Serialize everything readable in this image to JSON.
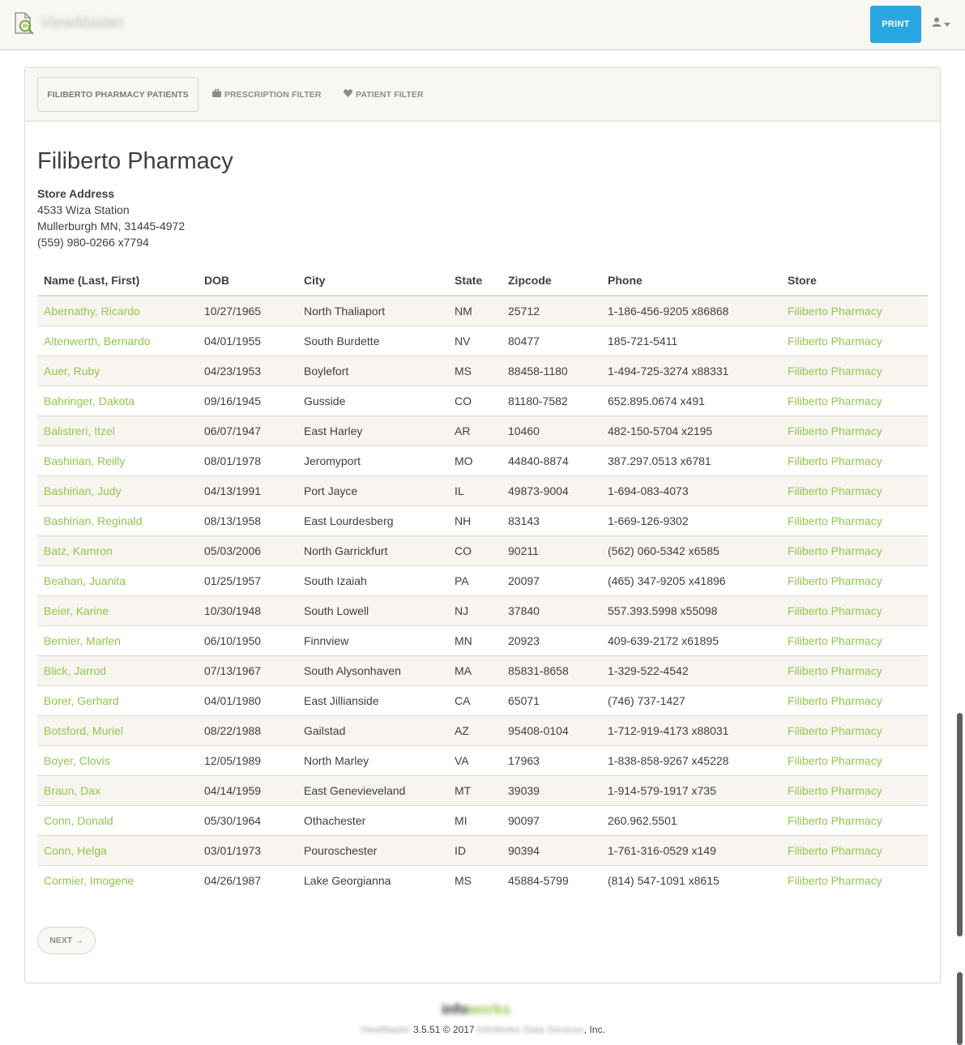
{
  "navbar": {
    "brand_name": "ViewMaster",
    "print_label": "PRINT"
  },
  "tabs": [
    {
      "label": "FILIBERTO PHARMACY PATIENTS",
      "icon": null
    },
    {
      "label": "PRESCRIPTION FILTER",
      "icon": "briefcase-icon"
    },
    {
      "label": "PATIENT FILTER",
      "icon": "heart-icon"
    }
  ],
  "store": {
    "name": "Filiberto Pharmacy",
    "address_label": "Store Address",
    "street": "4533 Wiza Station",
    "city_line": "Mullerburgh MN, 31445-4972",
    "phone": "(559) 980-0266 x7794"
  },
  "table": {
    "headers": {
      "name": "Name (Last, First)",
      "dob": "DOB",
      "city": "City",
      "state": "State",
      "zip": "Zipcode",
      "phone": "Phone",
      "store": "Store"
    },
    "rows": [
      {
        "name": "Abernathy, Ricardo",
        "dob": "10/27/1965",
        "city": "North Thaliaport",
        "state": "NM",
        "zip": "25712",
        "phone": "1-186-456-9205 x86868",
        "store": "Filiberto Pharmacy"
      },
      {
        "name": "Altenwerth, Bernardo",
        "dob": "04/01/1955",
        "city": "South Burdette",
        "state": "NV",
        "zip": "80477",
        "phone": "185-721-5411",
        "store": "Filiberto Pharmacy"
      },
      {
        "name": "Auer, Ruby",
        "dob": "04/23/1953",
        "city": "Boylefort",
        "state": "MS",
        "zip": "88458-1180",
        "phone": "1-494-725-3274 x88331",
        "store": "Filiberto Pharmacy"
      },
      {
        "name": "Bahringer, Dakota",
        "dob": "09/16/1945",
        "city": "Gusside",
        "state": "CO",
        "zip": "81180-7582",
        "phone": "652.895.0674 x491",
        "store": "Filiberto Pharmacy"
      },
      {
        "name": "Balistreri, Itzel",
        "dob": "06/07/1947",
        "city": "East Harley",
        "state": "AR",
        "zip": "10460",
        "phone": "482-150-5704 x2195",
        "store": "Filiberto Pharmacy"
      },
      {
        "name": "Bashirian, Reilly",
        "dob": "08/01/1978",
        "city": "Jeromyport",
        "state": "MO",
        "zip": "44840-8874",
        "phone": "387.297.0513 x6781",
        "store": "Filiberto Pharmacy"
      },
      {
        "name": "Bashirian, Judy",
        "dob": "04/13/1991",
        "city": "Port Jayce",
        "state": "IL",
        "zip": "49873-9004",
        "phone": "1-694-083-4073",
        "store": "Filiberto Pharmacy"
      },
      {
        "name": "Bashirian, Reginald",
        "dob": "08/13/1958",
        "city": "East Lourdesberg",
        "state": "NH",
        "zip": "83143",
        "phone": "1-669-126-9302",
        "store": "Filiberto Pharmacy"
      },
      {
        "name": "Batz, Kamron",
        "dob": "05/03/2006",
        "city": "North Garrickfurt",
        "state": "CO",
        "zip": "90211",
        "phone": "(562) 060-5342 x6585",
        "store": "Filiberto Pharmacy"
      },
      {
        "name": "Beahan, Juanita",
        "dob": "01/25/1957",
        "city": "South Izaiah",
        "state": "PA",
        "zip": "20097",
        "phone": "(465) 347-9205 x41896",
        "store": "Filiberto Pharmacy"
      },
      {
        "name": "Beier, Karine",
        "dob": "10/30/1948",
        "city": "South Lowell",
        "state": "NJ",
        "zip": "37840",
        "phone": "557.393.5998 x55098",
        "store": "Filiberto Pharmacy"
      },
      {
        "name": "Bernier, Marlen",
        "dob": "06/10/1950",
        "city": "Finnview",
        "state": "MN",
        "zip": "20923",
        "phone": "409-639-2172 x61895",
        "store": "Filiberto Pharmacy"
      },
      {
        "name": "Blick, Jarrod",
        "dob": "07/13/1967",
        "city": "South Alysonhaven",
        "state": "MA",
        "zip": "85831-8658",
        "phone": "1-329-522-4542",
        "store": "Filiberto Pharmacy"
      },
      {
        "name": "Borer, Gerhard",
        "dob": "04/01/1980",
        "city": "East Jillianside",
        "state": "CA",
        "zip": "65071",
        "phone": "(746) 737-1427",
        "store": "Filiberto Pharmacy"
      },
      {
        "name": "Botsford, Muriel",
        "dob": "08/22/1988",
        "city": "Gailstad",
        "state": "AZ",
        "zip": "95408-0104",
        "phone": "1-712-919-4173 x88031",
        "store": "Filiberto Pharmacy"
      },
      {
        "name": "Boyer, Clovis",
        "dob": "12/05/1989",
        "city": "North Marley",
        "state": "VA",
        "zip": "17963",
        "phone": "1-838-858-9267 x45228",
        "store": "Filiberto Pharmacy"
      },
      {
        "name": "Braun, Dax",
        "dob": "04/14/1959",
        "city": "East Genevieveland",
        "state": "MT",
        "zip": "39039",
        "phone": "1-914-579-1917 x735",
        "store": "Filiberto Pharmacy"
      },
      {
        "name": "Conn, Donald",
        "dob": "05/30/1964",
        "city": "Othachester",
        "state": "MI",
        "zip": "90097",
        "phone": "260.962.5501",
        "store": "Filiberto Pharmacy"
      },
      {
        "name": "Conn, Helga",
        "dob": "03/01/1973",
        "city": "Pouroschester",
        "state": "ID",
        "zip": "90394",
        "phone": "1-761-316-0529 x149",
        "store": "Filiberto Pharmacy"
      },
      {
        "name": "Cormier, Imogene",
        "dob": "04/26/1987",
        "city": "Lake Georgianna",
        "state": "MS",
        "zip": "45884-5799",
        "phone": "(814) 547-1091 x8615",
        "store": "Filiberto Pharmacy"
      }
    ]
  },
  "pagination": {
    "next_label": "NEXT →"
  },
  "footer": {
    "logo_part1": "info",
    "logo_part2": "works",
    "app_name": "ViewMaster",
    "version_text": "3.5.51 © 2017",
    "company": "InfoWorks Data Services",
    "suffix": ", Inc."
  },
  "colors": {
    "accent_green": "#93c54b",
    "print_blue": "#2aa6e0",
    "navbar_bg": "#f8f7f3"
  }
}
